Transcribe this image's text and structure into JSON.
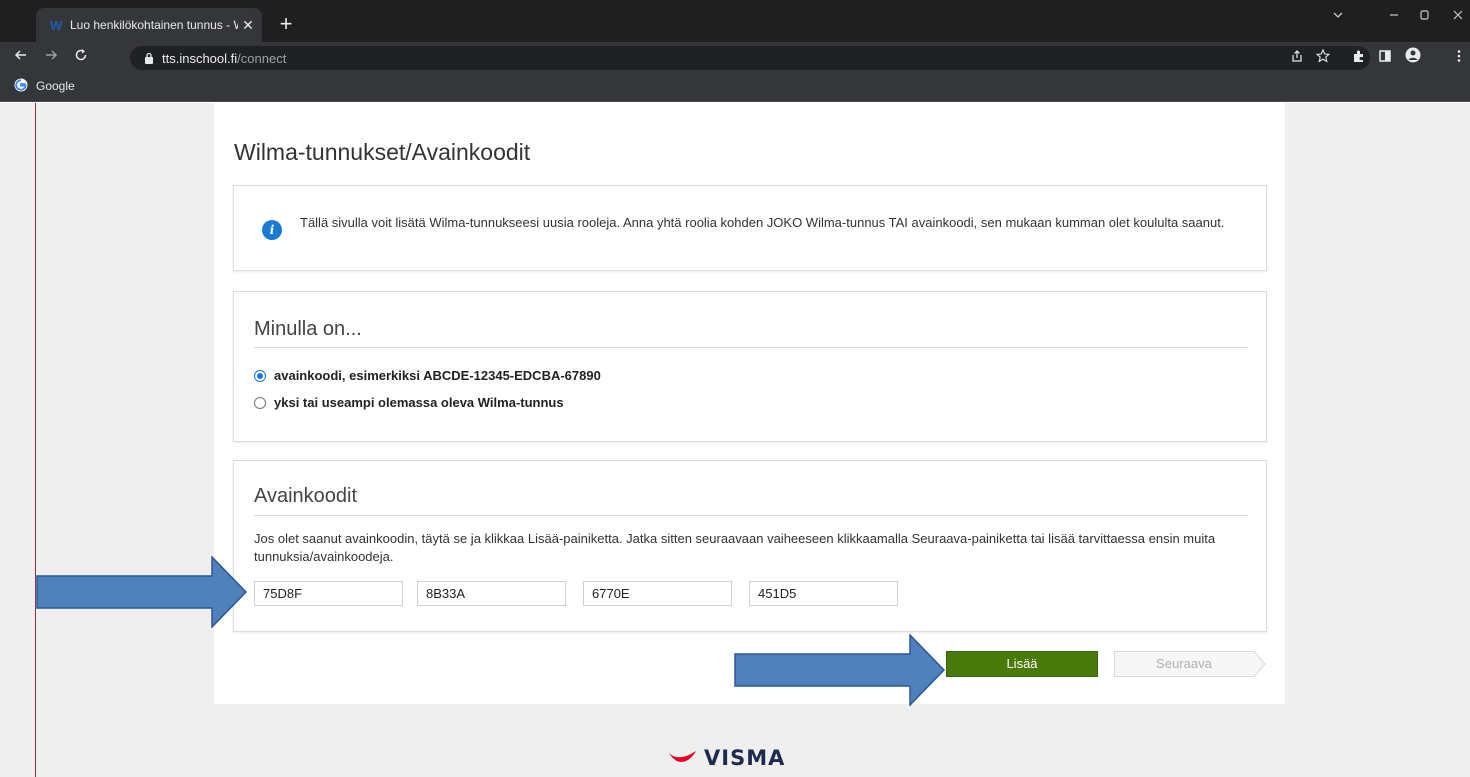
{
  "browser": {
    "tab_title": "Luo henkilökohtainen tunnus - Wilma",
    "tab_close": "✕",
    "new_tab": "+",
    "url_host": "tts.inschool.fi",
    "url_path": "/connect",
    "bookmark": "Google",
    "icons": [
      "back-icon",
      "forward-icon",
      "reload-icon",
      "lock-icon",
      "share-icon",
      "star-icon",
      "extensions-icon",
      "sidepanel-icon",
      "profile-icon",
      "menu-icon",
      "minimize-icon",
      "maximize-icon",
      "close-icon",
      "chevron-down-icon"
    ]
  },
  "page": {
    "title": "Wilma-tunnukset/Avainkoodit",
    "info_text": "Tällä sivulla voit lisätä Wilma-tunnukseesi uusia rooleja. Anna yhtä roolia kohden JOKO Wilma-tunnus TAI avainkoodi, sen mukaan kumman olet koululta saanut.",
    "roles": {
      "heading": "Minulla on...",
      "options": [
        {
          "label": "avainkoodi, esimerkiksi ABCDE-12345-EDCBA-67890",
          "checked": true
        },
        {
          "label": "yksi tai useampi olemassa oleva Wilma-tunnus",
          "checked": false
        }
      ]
    },
    "codes": {
      "heading": "Avainkoodit",
      "help_text": "Jos olet saanut avainkoodin, täytä se ja klikkaa Lisää-painiketta. Jatka sitten seuraavaan vaiheeseen klikkaamalla Seuraava-painiketta tai lisää tarvittaessa ensin muita tunnuksia/avainkoodeja.",
      "values": [
        "75D8F",
        "8B33A",
        "6770E",
        "451D5"
      ]
    },
    "add_button": "Lisää",
    "next_button": "Seuraava",
    "footer_brand": "VISMA"
  },
  "colors": {
    "accent_green": "#4a7a0b",
    "info_blue": "#1b7bd0",
    "annotation_arrow": "#4f81bd"
  }
}
